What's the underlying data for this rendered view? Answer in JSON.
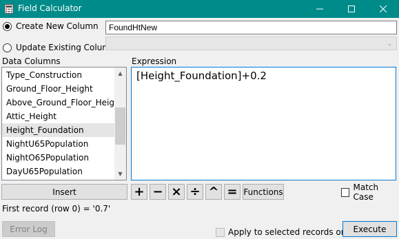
{
  "window": {
    "title": "Field Calculator",
    "minimize_icon": "minimize-icon",
    "maximize_icon": "maximize-icon",
    "close_icon": "close-icon",
    "accent": "#008b8b"
  },
  "create_new": {
    "label": "Create New Column",
    "value": "FoundHtNew",
    "checked": true
  },
  "update_existing": {
    "label": "Update Existing Column",
    "value": "",
    "checked": false
  },
  "columns": {
    "label": "Data Columns",
    "items": [
      "Type_Construction",
      "Ground_Floor_Height",
      "Above_Ground_Floor_Height",
      "Attic_Height",
      "Height_Foundation",
      "NightU65Population",
      "NightO65Population",
      "DayU65Population"
    ],
    "selected": "Height_Foundation"
  },
  "expression": {
    "label": "Expression",
    "value": "[Height_Foundation]+0.2"
  },
  "buttons": {
    "insert": "Insert",
    "plus": "+",
    "minus": "−",
    "multiply": "×",
    "divide": "÷",
    "power": "^",
    "equals": "=",
    "functions": "Functions",
    "error_log": "Error Log",
    "execute": "Execute"
  },
  "match_case": {
    "label": "Match Case",
    "checked": false
  },
  "apply_selected": {
    "label": "Apply to selected records only",
    "checked": false
  },
  "first_record": "First record (row 0) = '0.7'"
}
